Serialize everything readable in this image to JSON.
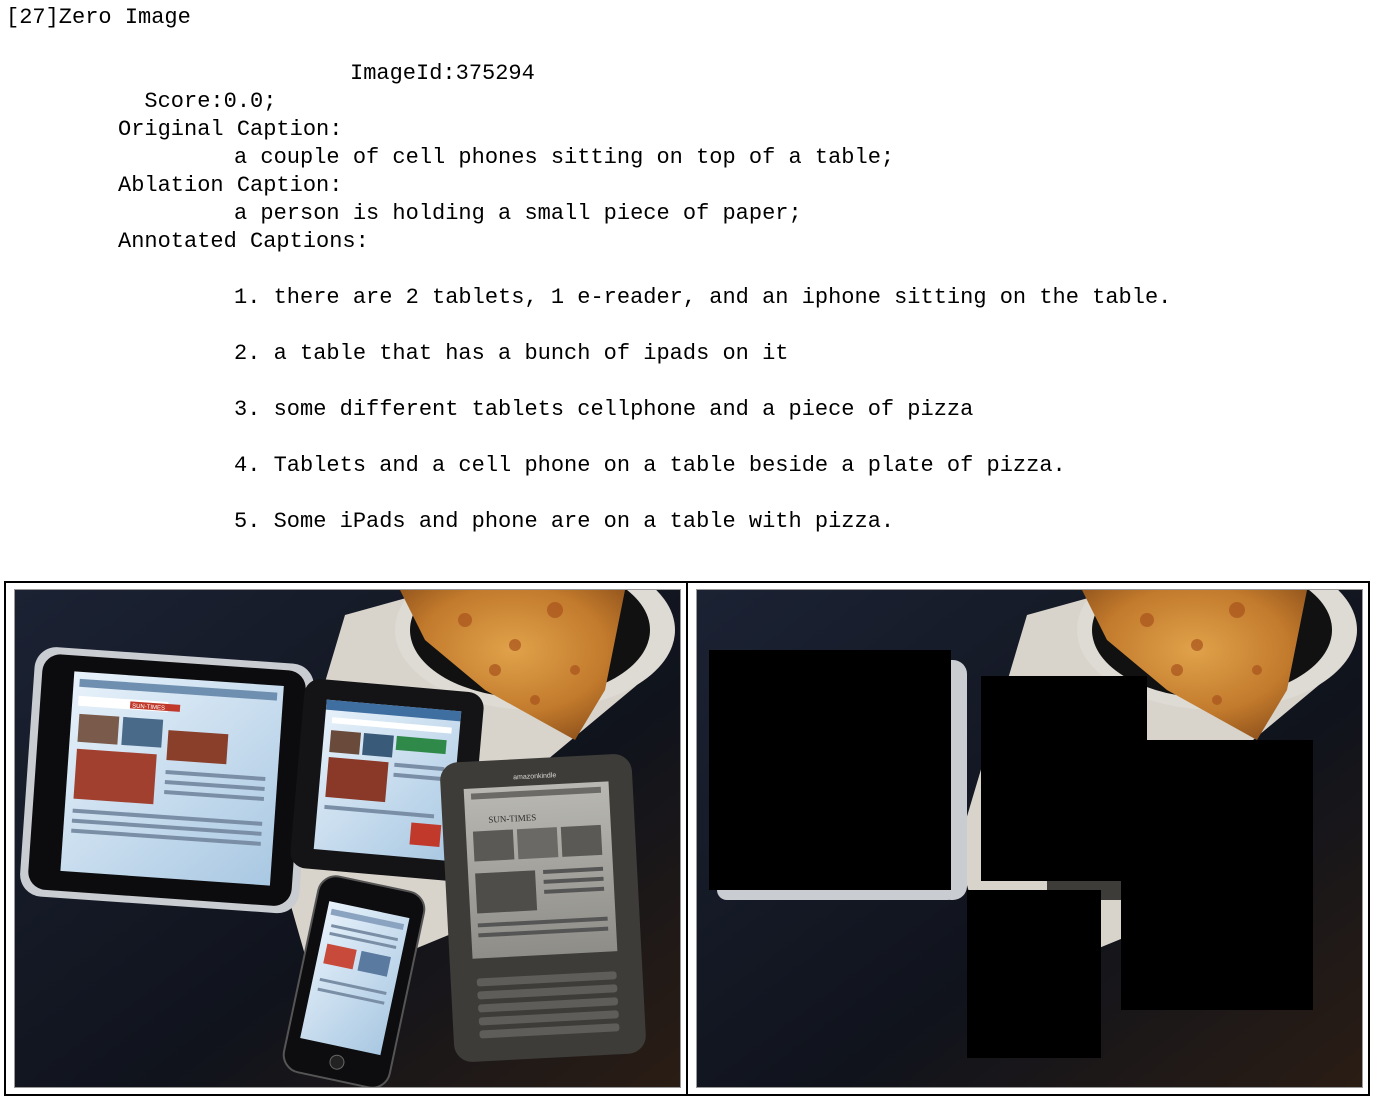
{
  "heading": "[27]Zero Image",
  "score": "Score:0.0;",
  "image_id": "ImageId:375294",
  "original_caption_label": "Original Caption:",
  "original_caption": "a couple of cell phones sitting on top of a table;",
  "ablation_caption_label": "Ablation Caption:",
  "ablation_caption": "a person is holding a small piece of paper;",
  "annotated_captions_label": "Annotated Captions:",
  "annotated_captions": [
    "1. there are 2 tablets, 1 e-reader, and an iphone sitting on the table.",
    "2. a table that has a bunch of ipads on it",
    "3. some different tablets cellphone and a piece of pizza",
    "4. Tablets and a cell phone on a table beside a plate of pizza.",
    "5. Some iPads and phone are on a table with pizza."
  ],
  "photo_text": {
    "ipad_masthead": "SUN-TIMES",
    "kindle_brand": "amazonkindle",
    "kindle_masthead": "SUN-TIMES"
  },
  "colors": {
    "table": "#13161f",
    "pizza": "#c9852e",
    "napkin": "#ece8e0",
    "screen": "#cfe3f2",
    "mask": "#000000"
  }
}
